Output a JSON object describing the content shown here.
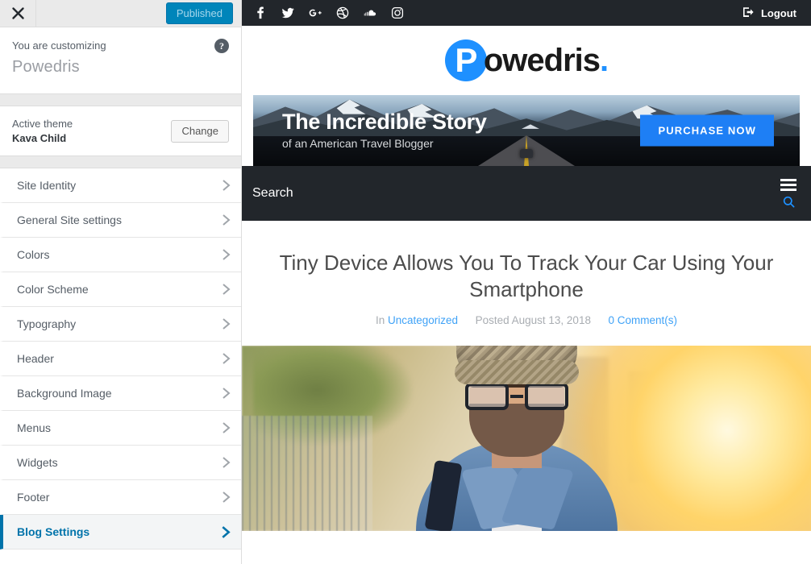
{
  "customizer": {
    "close_icon": "close-x-icon",
    "publish_button": "Published",
    "info": {
      "label": "You are customizing",
      "site_title": "Powedris",
      "help_icon": "question-mark-icon"
    },
    "theme": {
      "label": "Active theme",
      "name": "Kava Child",
      "change_button": "Change"
    },
    "panels": [
      {
        "label": "Site Identity",
        "active": false
      },
      {
        "label": "General Site settings",
        "active": false
      },
      {
        "label": "Colors",
        "active": false
      },
      {
        "label": "Color Scheme",
        "active": false
      },
      {
        "label": "Typography",
        "active": false
      },
      {
        "label": "Header",
        "active": false
      },
      {
        "label": "Background Image",
        "active": false
      },
      {
        "label": "Menus",
        "active": false
      },
      {
        "label": "Widgets",
        "active": false
      },
      {
        "label": "Footer",
        "active": false
      },
      {
        "label": "Blog Settings",
        "active": true
      }
    ]
  },
  "preview": {
    "topbar": {
      "social": [
        {
          "name": "facebook-icon",
          "glyph": "f"
        },
        {
          "name": "twitter-icon",
          "glyph": "t"
        },
        {
          "name": "google-plus-icon",
          "glyph": "G+"
        },
        {
          "name": "dribbble-icon",
          "glyph": "d"
        },
        {
          "name": "soundcloud-icon",
          "glyph": "s"
        },
        {
          "name": "instagram-icon",
          "glyph": "i"
        }
      ],
      "logout_label": "Logout"
    },
    "logo": {
      "initial": "P",
      "rest": "owedris",
      "dot": ".",
      "accent_color": "#1e90ff"
    },
    "banner": {
      "title": "The Incredible Story",
      "subtitle": "of an American Travel Blogger",
      "button_label": "PURCHASE NOW",
      "button_color": "#1e7ff5"
    },
    "nav": {
      "search_label": "Search",
      "menu_icon": "hamburger-menu-icon",
      "search_icon": "search-icon",
      "bar_color": "#22262b",
      "search_icon_color": "#1e90ff"
    },
    "post": {
      "title": "Tiny Device Allows You To Track Your Car Using Your Smartphone",
      "meta_in": "In",
      "category": "Uncategorized",
      "posted": "Posted August 13, 2018",
      "comments": "0 Comment(s)",
      "link_color": "#3fa2f7",
      "featured_image_alt": "man-in-beanie-and-glasses-photo"
    }
  }
}
